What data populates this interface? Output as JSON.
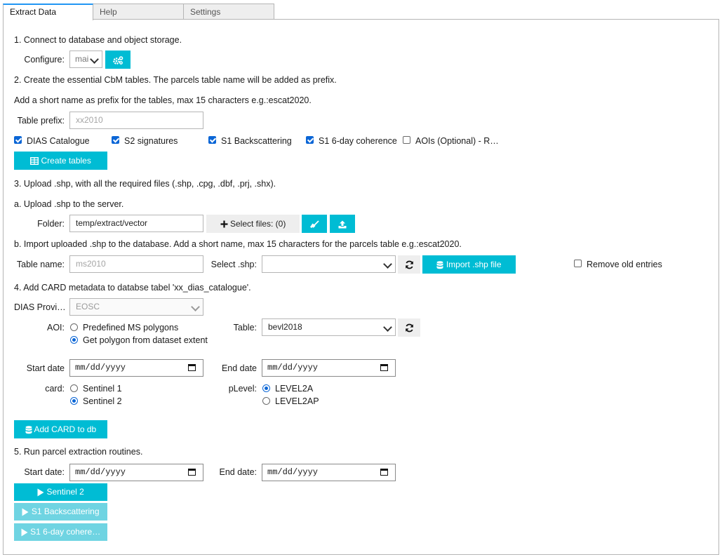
{
  "tabs": [
    "Extract Data",
    "Help",
    "Settings"
  ],
  "step1": {
    "title": "1. Connect to database and object storage.",
    "configure_label": "Configure:",
    "configure_value": "mai"
  },
  "step2": {
    "title": "2. Create the essential CbM tables. The parcels table name will be added as prefix.",
    "hint": "Add a short name as prefix for the tables, max 15 characters e.g.:escat2020.",
    "prefix_label": "Table prefix:",
    "prefix_placeholder": "xx2010",
    "checkboxes": [
      "DIAS Catalogue",
      "S2 signatures",
      "S1 Backscattering",
      "S1 6-day coherence",
      "AOIs (Optional) - R…"
    ],
    "create_button": "Create tables"
  },
  "step3": {
    "title": "3. Upload .shp, with all the required files (.shp, .cpg, .dbf, .prj, .shx).",
    "sub_a": "a. Upload .shp to the server.",
    "folder_label": "Folder:",
    "folder_value": "temp/extract/vector",
    "select_files": "Select files: (0)",
    "sub_b": "b. Import uploaded .shp to the database. Add a short name, max 15 characters for the parcels table e.g.:escat2020.",
    "table_name_label": "Table name:",
    "table_name_placeholder": "ms2010",
    "select_shp_label": "Select .shp:",
    "import_button": "Import .shp file",
    "remove_old": "Remove old entries"
  },
  "step4": {
    "title": "4. Add CARD metadata to databse tabel 'xx_dias_catalogue'.",
    "dias_label": "DIAS Provi…",
    "dias_value": "EOSC",
    "aoi_label": "AOI:",
    "aoi_options": [
      "Predefined MS polygons",
      "Get polygon from dataset extent"
    ],
    "table_label": "Table:",
    "table_value": "bevl2018",
    "start_label": "Start date",
    "end_label": "End date",
    "date_placeholder": "mm/dd/yyyy",
    "card_label": "card:",
    "card_options": [
      "Sentinel 1",
      "Sentinel 2"
    ],
    "plevel_label": "pLevel:",
    "plevel_options": [
      "LEVEL2A",
      "LEVEL2AP"
    ],
    "add_button": "Add CARD to db"
  },
  "step5": {
    "title": "5. Run parcel extraction routines.",
    "start_label": "Start date:",
    "end_label": "End date:",
    "date_placeholder": "mm/dd/yyyy",
    "buttons": [
      "Sentinel 2",
      "S1 Backscattering",
      "S1 6-day cohere…"
    ]
  },
  "colors": {
    "accent": "#00bcd4",
    "accent_dim": "#6fd4e2",
    "tab_active": "#2196f3",
    "check": "#0b66d6"
  },
  "icons": [
    "gears-icon",
    "table-icon",
    "plus-icon",
    "broom-icon",
    "upload-icon",
    "refresh-icon",
    "database-icon",
    "play-icon",
    "calendar-icon"
  ]
}
